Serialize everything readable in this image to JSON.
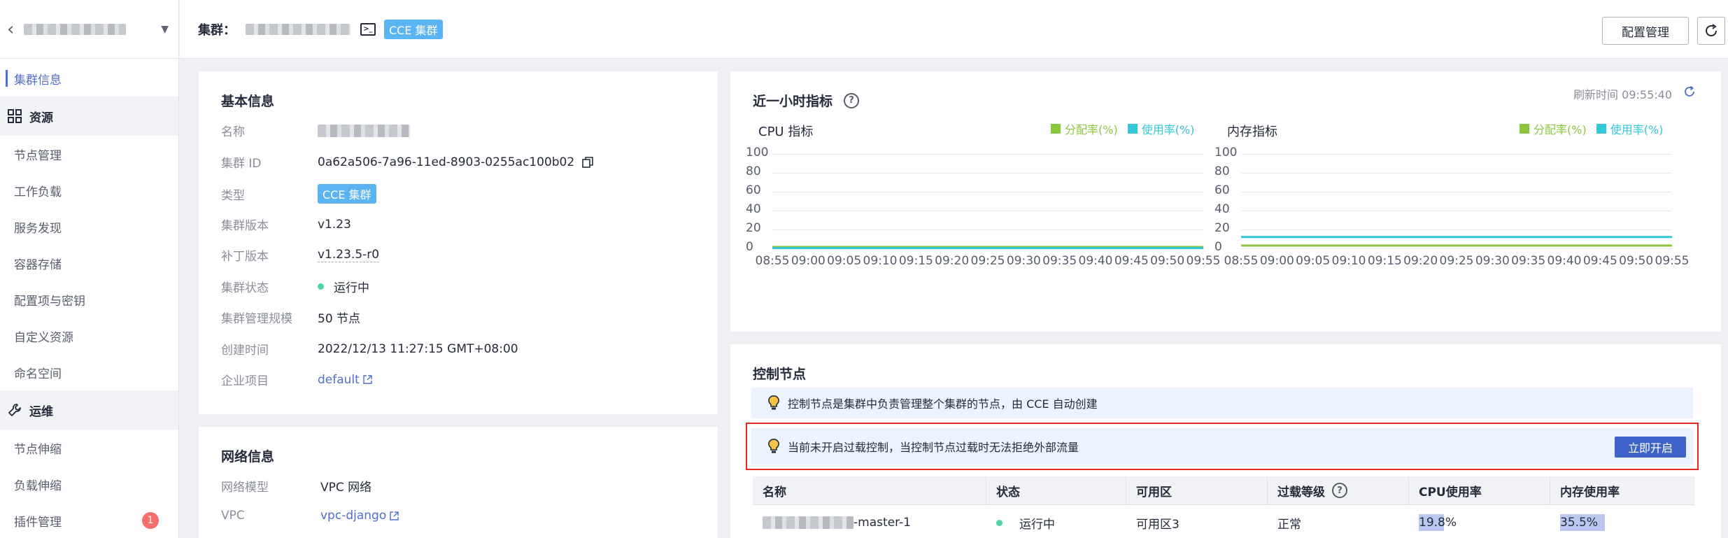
{
  "sidebar": {
    "items": [
      {
        "label": "集群信息",
        "active": true
      },
      {
        "group": "资源",
        "icon": "grid-icon"
      },
      {
        "label": "节点管理"
      },
      {
        "label": "工作负载"
      },
      {
        "label": "服务发现"
      },
      {
        "label": "容器存储"
      },
      {
        "label": "配置项与密钥"
      },
      {
        "label": "自定义资源"
      },
      {
        "label": "命名空间"
      },
      {
        "group": "运维",
        "icon": "wrench-icon"
      },
      {
        "label": "节点伸缩"
      },
      {
        "label": "负载伸缩"
      },
      {
        "label": "插件管理",
        "badge": "1"
      }
    ]
  },
  "header": {
    "cluster_label": "集群：",
    "cluster_type_tag": "CCE 集群",
    "config_button": "配置管理"
  },
  "basic_info": {
    "title": "基本信息",
    "rows": [
      {
        "key": "名称",
        "value": ""
      },
      {
        "key": "集群 ID",
        "value": "0a62a506-7a96-11ed-8903-0255ac100b02"
      },
      {
        "key": "类型",
        "value": "CCE 集群"
      },
      {
        "key": "集群版本",
        "value": "v1.23"
      },
      {
        "key": "补丁版本",
        "value": "v1.23.5-r0"
      },
      {
        "key": "集群状态",
        "value": "运行中"
      },
      {
        "key": "集群管理规模",
        "value": "50 节点"
      },
      {
        "key": "创建时间",
        "value": "2022/12/13 11:27:15 GMT+08:00"
      },
      {
        "key": "企业项目",
        "value": "default"
      }
    ]
  },
  "network_info": {
    "title": "网络信息",
    "rows": [
      {
        "key": "网络模型",
        "value": "VPC 网络"
      },
      {
        "key": "VPC",
        "value": "vpc-django"
      }
    ]
  },
  "metrics": {
    "title": "近一小时指标",
    "refresh_time": "刷新时间 09:55:40",
    "colors": {
      "alloc": "#8cc63f",
      "usage": "#33c7d8",
      "grid": "#e6e7ea"
    }
  },
  "chart_data": [
    {
      "type": "line",
      "title": "CPU 指标",
      "x": [
        "08:55",
        "09:00",
        "09:05",
        "09:10",
        "09:15",
        "09:20",
        "09:25",
        "09:30",
        "09:35",
        "09:40",
        "09:45",
        "09:50",
        "09:55"
      ],
      "ylim": [
        0,
        100
      ],
      "yticks": [
        100,
        80,
        60,
        40,
        20,
        0
      ],
      "series": [
        {
          "name": "分配率(%)",
          "values": [
            1.5,
            1.5,
            1.5,
            1.5,
            1.5,
            1.5,
            1.5,
            1.5,
            1.5,
            1.5,
            1.5,
            1.5,
            1.5
          ]
        },
        {
          "name": "使用率(%)",
          "values": [
            0.3,
            0.3,
            0.3,
            0.3,
            0.3,
            0.3,
            0.3,
            0.3,
            0.3,
            0.3,
            0.3,
            0.3,
            0.3
          ]
        }
      ]
    },
    {
      "type": "line",
      "title": "内存指标",
      "x": [
        "08:55",
        "09:00",
        "09:05",
        "09:10",
        "09:15",
        "09:20",
        "09:25",
        "09:30",
        "09:35",
        "09:40",
        "09:45",
        "09:50",
        "09:55"
      ],
      "ylim": [
        0,
        100
      ],
      "yticks": [
        100,
        80,
        60,
        40,
        20,
        0
      ],
      "series": [
        {
          "name": "分配率(%)",
          "values": [
            3,
            3,
            3,
            3,
            3,
            3,
            3,
            3,
            3,
            3,
            3,
            3,
            3
          ]
        },
        {
          "name": "使用率(%)",
          "values": [
            12,
            12,
            12,
            12,
            12,
            12,
            12,
            12,
            12,
            12,
            12,
            12,
            12
          ]
        }
      ]
    }
  ],
  "control_nodes": {
    "title": "控制节点",
    "info_notice": "控制节点是集群中负责管理整个集群的节点，由 CCE 自动创建",
    "overload_notice": "当前未开启过载控制，当控制节点过载时无法拒绝外部流量",
    "enable_button": "立即开启",
    "columns": [
      "名称",
      "状态",
      "可用区",
      "过载等级",
      "CPU使用率",
      "内存使用率"
    ],
    "rows": [
      {
        "name_suffix": "-master-1",
        "status": "运行中",
        "zone": "可用区3",
        "overload": "正常",
        "cpu": "19.8%",
        "cpu_value": 19.8,
        "mem": "35.5%",
        "mem_value": 35.5
      }
    ]
  }
}
